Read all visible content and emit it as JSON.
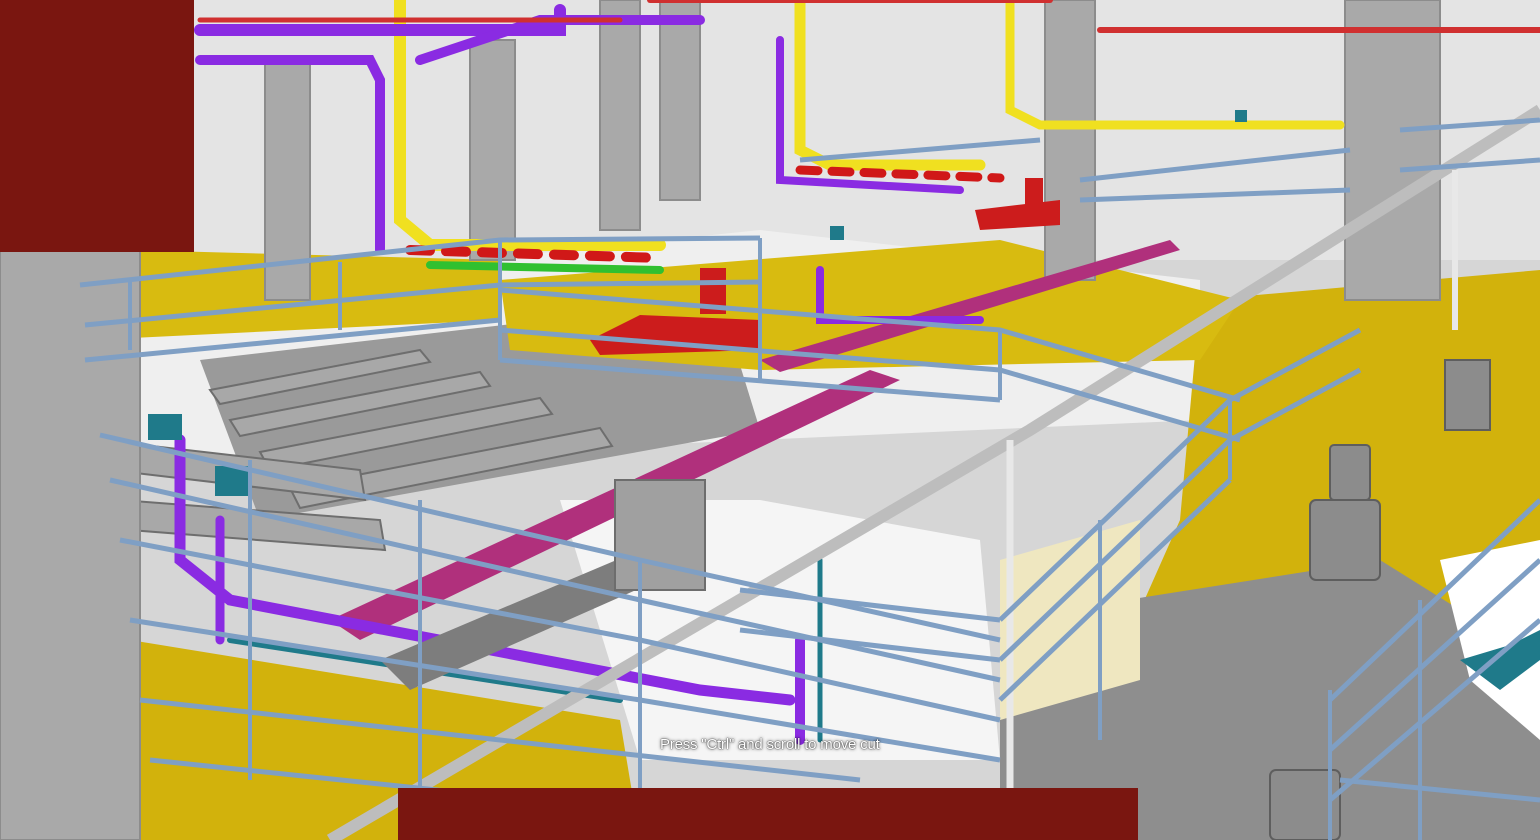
{
  "viewer": {
    "hint_text": "Press \"Ctrl\" and scroll to move cut"
  },
  "colors": {
    "overlay": "#7a1610",
    "floor_yellow": "#d4b40c",
    "railing_blue": "#7f9fc4",
    "pipe_purple": "#8a2be2",
    "pipe_yellow": "#f0e020",
    "pipe_red": "#d01818",
    "pipe_green": "#30c030",
    "pipe_magenta": "#b0307c",
    "equipment_teal": "#1f7a8a",
    "column_gray": "#a9a9a9",
    "wall_white": "#f2f2f2"
  }
}
